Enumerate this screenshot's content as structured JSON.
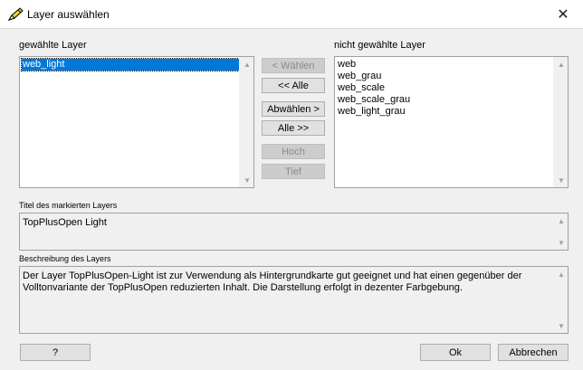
{
  "window": {
    "title": "Layer auswählen",
    "icon": "pencil-app-icon",
    "close_symbol": "✕"
  },
  "selected_layers": {
    "label": "gewählte Layer",
    "items": [
      "web_light"
    ],
    "selected_index": 0
  },
  "unselected_layers": {
    "label": "nicht gewählte Layer",
    "items": [
      "web",
      "web_grau",
      "web_scale",
      "web_scale_grau",
      "web_light_grau"
    ]
  },
  "buttons": {
    "select": "< Wählen",
    "select_all": "<< Alle",
    "deselect": "Abwählen >",
    "deselect_all": "Alle >>",
    "up": "Hoch",
    "down": "Tief",
    "help": "?",
    "ok": "Ok",
    "cancel": "Abbrechen"
  },
  "title_field": {
    "label": "Titel des markierten Layers",
    "value": "TopPlusOpen Light"
  },
  "description_field": {
    "label": "Beschreibung des Layers",
    "line1": "Der Layer TopPlusOpen-Light ist zur Verwendung als Hintergrundkarte gut geeignet und hat einen gegenüber der",
    "line2": "Volltonvariante der TopPlusOpen reduzierten Inhalt. Die Darstellung erfolgt in dezenter Farbgebung."
  },
  "icons": {
    "scroll_up": "▲",
    "scroll_down": "▼"
  },
  "colors": {
    "selection": "#0078d7",
    "dialog_bg": "#f0f0f0",
    "disabled_text": "#8a8a8a"
  }
}
